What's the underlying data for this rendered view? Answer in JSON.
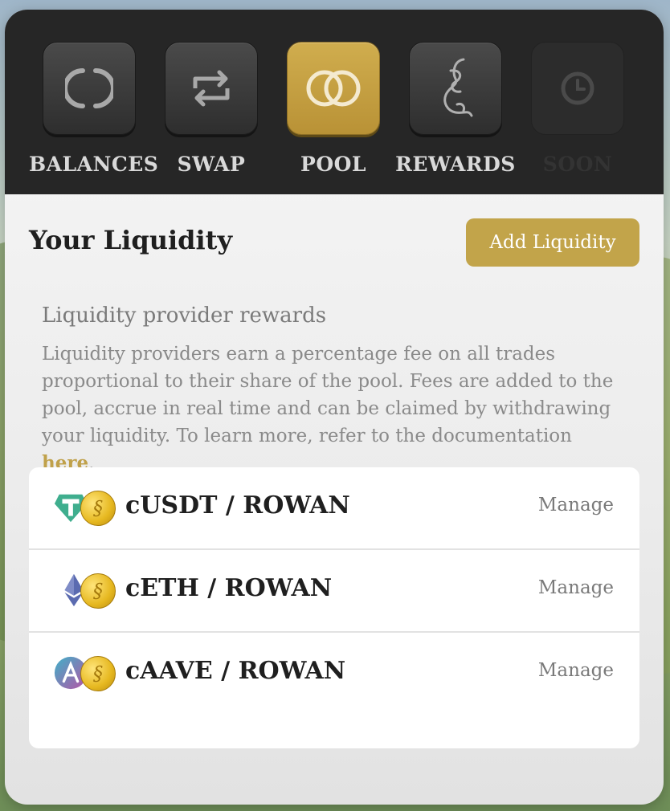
{
  "nav": [
    {
      "label": "BALANCES",
      "icon": "balances-icon",
      "active": false
    },
    {
      "label": "SWAP",
      "icon": "swap-icon",
      "active": false
    },
    {
      "label": "POOL",
      "icon": "pool-icon",
      "active": true
    },
    {
      "label": "REWARDS",
      "icon": "rewards-icon",
      "active": false
    },
    {
      "label": "SOON",
      "icon": "clock-icon",
      "active": false
    }
  ],
  "liquidity": {
    "title": "Your Liquidity",
    "add_button": "Add Liquidity"
  },
  "info": {
    "title": "Liquidity provider rewards",
    "body": "Liquidity providers earn a percentage fee on all trades proportional to their share of the pool. Fees are added to the pool, accrue in real time and can be claimed by withdrawing your liquidity. To learn more, refer to the documentation ",
    "link": "here",
    "end": "."
  },
  "pools": [
    {
      "pair": "cUSDT / ROWAN",
      "manage": "Manage",
      "token_icon": "usdt-icon"
    },
    {
      "pair": "cETH / ROWAN",
      "manage": "Manage",
      "token_icon": "eth-icon"
    },
    {
      "pair": "cAAVE / ROWAN",
      "manage": "Manage",
      "token_icon": "aave-icon"
    }
  ],
  "colors": {
    "accent": "#c2a44a",
    "nav_bg": "#262626"
  }
}
